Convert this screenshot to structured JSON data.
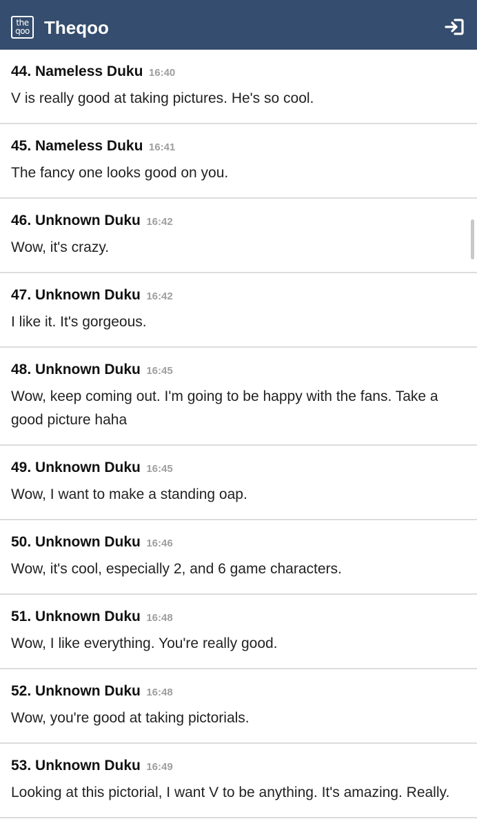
{
  "header": {
    "logo_text": "the qoo",
    "title": "Theqoo",
    "login_icon": "sign-in-icon",
    "background_color": "#354d6e"
  },
  "comments": [
    {
      "number": "44.",
      "author": "Nameless Duku",
      "time": "16:40",
      "text": "V is really good at taking pictures. He's so cool."
    },
    {
      "number": "45.",
      "author": "Nameless Duku",
      "time": "16:41",
      "text": "The fancy one looks good on you."
    },
    {
      "number": "46.",
      "author": "Unknown Duku",
      "time": "16:42",
      "text": "Wow, it's crazy."
    },
    {
      "number": "47.",
      "author": "Unknown Duku",
      "time": "16:42",
      "text": "I like it. It's gorgeous."
    },
    {
      "number": "48.",
      "author": "Unknown Duku",
      "time": "16:45",
      "text": "Wow, keep coming out. I'm going to be happy with the fans. Take a good picture haha"
    },
    {
      "number": "49.",
      "author": "Unknown Duku",
      "time": "16:45",
      "text": "Wow, I want to make a standing oap."
    },
    {
      "number": "50.",
      "author": "Unknown Duku",
      "time": "16:46",
      "text": "Wow, it's cool, especially 2, and 6 game characters."
    },
    {
      "number": "51.",
      "author": "Unknown Duku",
      "time": "16:48",
      "text": "Wow, I like everything. You're really good."
    },
    {
      "number": "52.",
      "author": "Unknown Duku",
      "time": "16:48",
      "text": "Wow, you're good at taking pictorials."
    },
    {
      "number": "53.",
      "author": "Unknown Duku",
      "time": "16:49",
      "text": "Looking at this pictorial, I want V to be anything. It's amazing. Really."
    }
  ]
}
